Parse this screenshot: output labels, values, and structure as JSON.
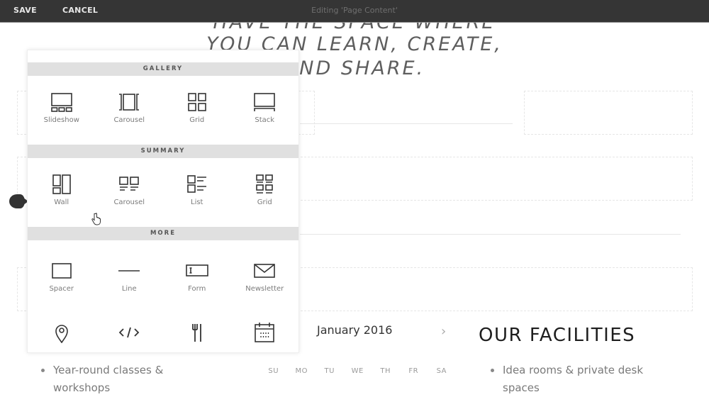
{
  "topbar": {
    "save_label": "SAVE",
    "cancel_label": "CANCEL",
    "title": "Editing 'Page Content'"
  },
  "page": {
    "hero_lines": [
      "HAVE THE SPACE WHERE",
      "YOU CAN LEARN, CREATE,",
      "AND SHARE."
    ],
    "calendar": {
      "month": "January 2016",
      "next_icon": "chevron-right-icon",
      "days": [
        "SU",
        "MO",
        "TU",
        "WE",
        "TH",
        "FR",
        "SA"
      ]
    },
    "left_list": [
      "Year-round classes & workshops"
    ],
    "facilities": {
      "title": "OUR FACILITIES",
      "items": [
        "Idea rooms & private desk spaces"
      ]
    }
  },
  "panel": {
    "sections": [
      {
        "title": "GALLERY",
        "items": [
          {
            "label": "Slideshow",
            "icon": "slideshow-icon"
          },
          {
            "label": "Carousel",
            "icon": "carousel-icon"
          },
          {
            "label": "Grid",
            "icon": "grid-icon"
          },
          {
            "label": "Stack",
            "icon": "stack-icon"
          }
        ]
      },
      {
        "title": "SUMMARY",
        "items": [
          {
            "label": "Wall",
            "icon": "wall-icon"
          },
          {
            "label": "Carousel",
            "icon": "summary-carousel-icon"
          },
          {
            "label": "List",
            "icon": "list-icon"
          },
          {
            "label": "Grid",
            "icon": "summary-grid-icon"
          }
        ]
      },
      {
        "title": "MORE",
        "items": [
          {
            "label": "Spacer",
            "icon": "spacer-icon"
          },
          {
            "label": "Line",
            "icon": "line-icon"
          },
          {
            "label": "Form",
            "icon": "form-icon"
          },
          {
            "label": "Newsletter",
            "icon": "newsletter-icon"
          },
          {
            "label": "",
            "icon": "map-pin-icon"
          },
          {
            "label": "",
            "icon": "code-icon"
          },
          {
            "label": "",
            "icon": "menu-fork-knife-icon"
          },
          {
            "label": "",
            "icon": "calendar-icon"
          }
        ]
      }
    ]
  },
  "colors": {
    "topbar_bg": "#353535",
    "section_header_bg": "#e0e0e0",
    "icon_stroke": "#333333"
  }
}
